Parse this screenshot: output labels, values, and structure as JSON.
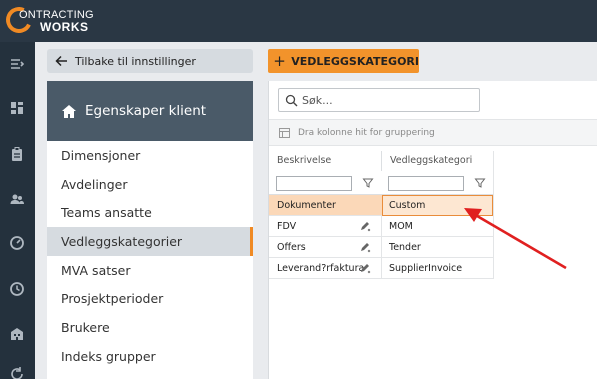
{
  "brand": {
    "line1": "ONTRACTING",
    "line2": "WORKS",
    "accent_color": "#f08a24"
  },
  "rail": {
    "icons": [
      "menu-collapse-icon",
      "dashboard-icon",
      "clipboard-icon",
      "people-icon",
      "gauge-icon",
      "clock-icon",
      "building-icon",
      "refresh-icon"
    ]
  },
  "back_button": {
    "label": "Tilbake til innstillinger",
    "icon": "arrow-left-icon"
  },
  "panel": {
    "title": "Egenskaper klient",
    "icon": "home-icon",
    "items": [
      {
        "label": "Dimensjoner",
        "active": false
      },
      {
        "label": "Avdelinger",
        "active": false
      },
      {
        "label": "Teams ansatte",
        "active": false
      },
      {
        "label": "Vedleggskategorier",
        "active": true
      },
      {
        "label": "MVA satser",
        "active": false
      },
      {
        "label": "Prosjektperioder",
        "active": false
      },
      {
        "label": "Brukere",
        "active": false
      },
      {
        "label": "Indeks grupper",
        "active": false
      }
    ]
  },
  "add_button": {
    "label": "VEDLEGGSKATEGORI",
    "icon": "plus-icon"
  },
  "grid": {
    "search_placeholder": "Søk...",
    "group_hint": "Dra kolonne hit for gruppering",
    "columns": [
      "Beskrivelse",
      "Vedleggskategori"
    ],
    "rows": [
      {
        "beskrivelse": "Dokumenter",
        "kategori": "Custom",
        "selected": true,
        "editable": false
      },
      {
        "beskrivelse": "FDV",
        "kategori": "MOM",
        "selected": false,
        "editable": true
      },
      {
        "beskrivelse": "Offers",
        "kategori": "Tender",
        "selected": false,
        "editable": true
      },
      {
        "beskrivelse": "Leverand?rfaktura",
        "kategori": "SupplierInvoice",
        "selected": false,
        "editable": true
      }
    ]
  },
  "annotation_arrow_color": "#e02020"
}
